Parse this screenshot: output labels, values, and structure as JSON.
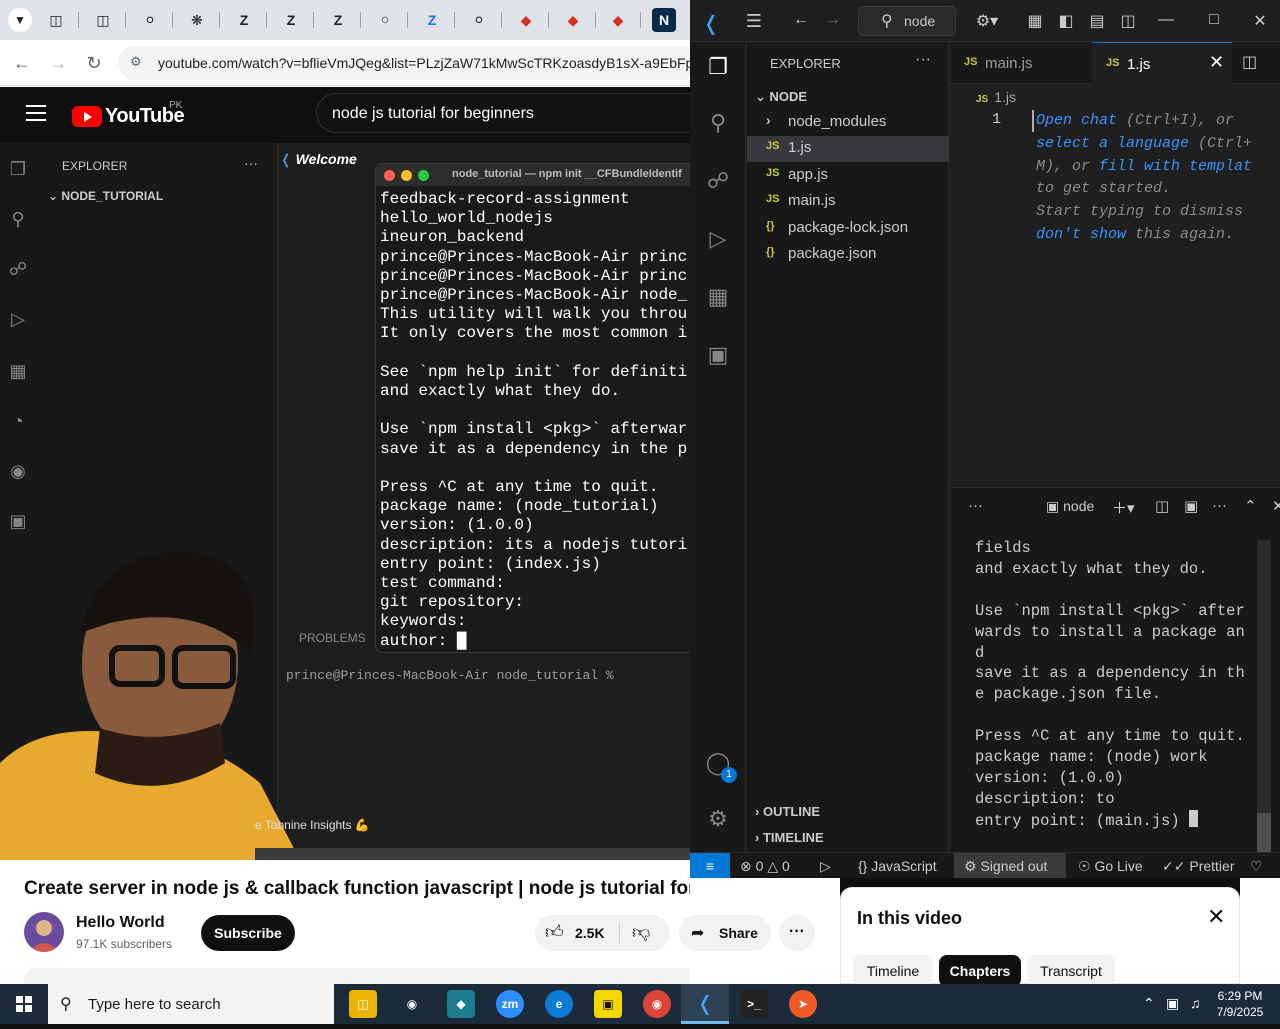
{
  "browser": {
    "url": "youtube.com/watch?v=bflieVmJQeg&list=PLzjZaW71kMwScTRKzoasdyB1sX-a9EbFp&",
    "tab_letters": [
      "Z",
      "Z",
      "Z",
      "Z"
    ]
  },
  "youtube": {
    "logo_text": "YouTube",
    "country": "PK",
    "search_query": "node js tutorial for beginners",
    "video_title": "Create server in node js & callback function javascript | node js tutorial for beginners",
    "channel_name": "Hello World",
    "subscribers": "97.1K subscribers",
    "subscribe_label": "Subscribe",
    "likes": "2.5K",
    "share_label": "Share",
    "more_label": "···"
  },
  "video_frame": {
    "explorer_title": "EXPLORER",
    "folder": "NODE_TUTORIAL",
    "welcome_tab": "Welcome",
    "terminal_title": "node_tutorial — npm init __CFBundleIdentif",
    "terminal_lines": [
      "feedback-record-assignment",
      "hello_world_nodejs",
      "ineuron_backend",
      "prince@Princes-MacBook-Air princ",
      "prince@Princes-MacBook-Air princ",
      "prince@Princes-MacBook-Air node_",
      "This utility will walk you throu",
      "It only covers the most common i",
      "",
      "See `npm help init` for definiti",
      "and exactly what they do.",
      "",
      "Use `npm install <pkg>` afterwar",
      "save it as a dependency in the p",
      "",
      "Press ^C at any time to quit.",
      "package name: (node_tutorial)",
      "version: (1.0.0)",
      "description: its a nodejs tutori",
      "entry point: (index.js)",
      "test command:",
      "git repository:",
      "keywords:",
      "author: █"
    ],
    "problems_label": "PROBLEMS",
    "prompt": "prince@Princes-MacBook-Air node_tutorial %",
    "tabnine": "e Tabnine Insights 💪"
  },
  "vscode": {
    "command_center": "node",
    "explorer_title": "EXPLORER",
    "folder": "NODE",
    "files": [
      {
        "name": "node_modules",
        "type": "folder"
      },
      {
        "name": "1.js",
        "type": "js"
      },
      {
        "name": "app.js",
        "type": "js"
      },
      {
        "name": "main.js",
        "type": "js"
      },
      {
        "name": "package-lock.json",
        "type": "json"
      },
      {
        "name": "package.json",
        "type": "json"
      }
    ],
    "outline": "OUTLINE",
    "timeline": "TIMELINE",
    "tabs": [
      "main.js",
      "1.js"
    ],
    "breadcrumb": "1.js",
    "line_number": "1",
    "hint": {
      "open_chat": "Open chat",
      "ctrl_i": " (Ctrl+I), or",
      "select_language": "select a language",
      "ctrl_m_a": " (Ctrl+",
      "ctrl_m_b": "M), or ",
      "fill_template": "fill with templat",
      "get_started": "to get started.",
      "start_typing": "Start typing to dismiss",
      "dont_show": "don't show",
      "this_again": " this again."
    },
    "terminal_name": "node",
    "terminal_lines": [
      "fields",
      "and exactly what they do.",
      "",
      "Use `npm install <pkg>` after",
      "wards to install a package an",
      "d",
      "save it as a dependency in th",
      "e package.json file.",
      "",
      "Press ^C at any time to quit.",
      "package name: (node) work",
      "version: (1.0.0)",
      "description: to",
      "entry point: (main.js) "
    ],
    "status": {
      "errors": "0",
      "warnings": "0",
      "language": "JavaScript",
      "signed_out": "Signed out",
      "go_live": "Go Live",
      "prettier": "Prettier"
    },
    "accounts_badge": "1"
  },
  "chapters_panel": {
    "title": "In this video",
    "chips": [
      "Timeline",
      "Chapters",
      "Transcript"
    ]
  },
  "taskbar": {
    "search_placeholder": "Type here to search",
    "time": "6:29 PM",
    "date": "7/9/2025"
  }
}
